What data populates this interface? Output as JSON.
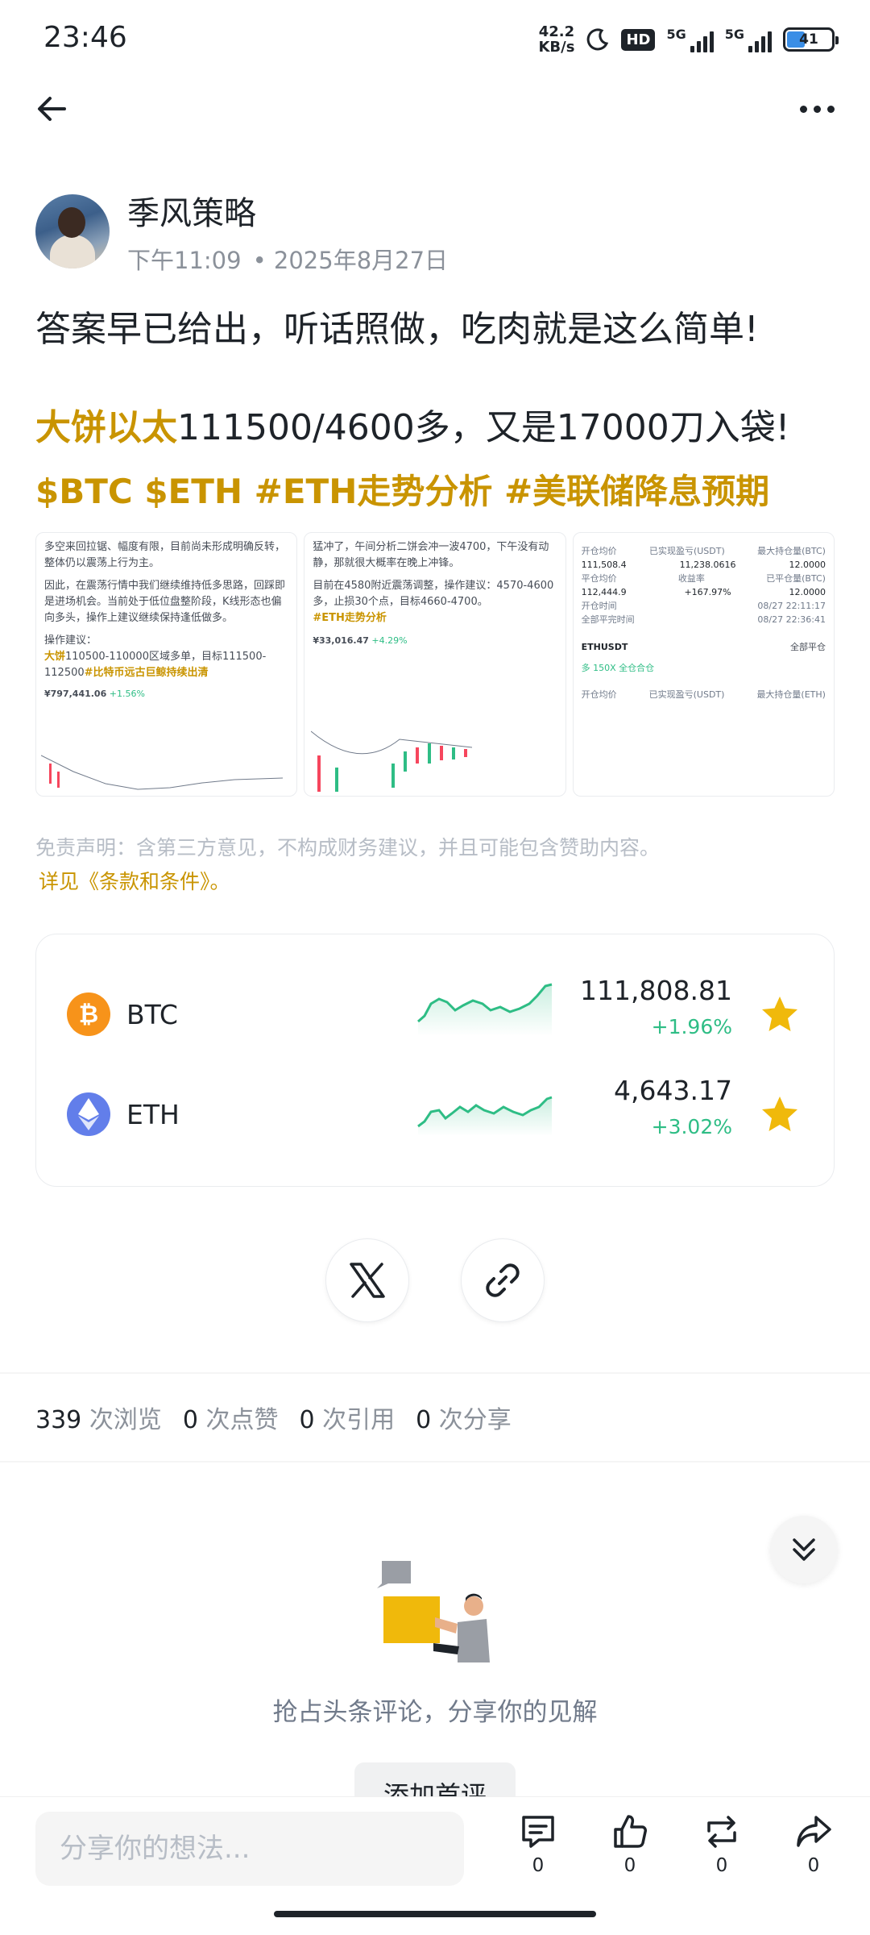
{
  "status_bar": {
    "time": "23:46",
    "net_speed_value": "42.2",
    "net_speed_unit": "KB/s",
    "hd_label": "HD",
    "signal1_label": "5G",
    "signal2_label": "5G",
    "battery": "41"
  },
  "nav": {
    "back_icon": "arrow-left-icon",
    "more_icon": "more-dots-icon"
  },
  "author": {
    "name": "季风策略",
    "time": "下午11:09",
    "date": "• 2025年8月27日"
  },
  "post": {
    "line1": "答案早已给出，听话照做，吃肉就是这么简单!",
    "highlight": "大饼以太",
    "line2_rest": "111500/4600多，又是17000刀入袋!",
    "tags": "$BTC $ETH #ETH走势分析 #美联储降息预期"
  },
  "screenshots": {
    "shot1": {
      "p1": "多空来回拉锯、幅度有限，目前尚未形成明确反转，整体仍以震荡上行为主。",
      "p2": "因此，在震荡行情中我们继续维持低多思路，回踩即是进场机会。当前处于低位盘整阶段，K线形态也偏向多头，操作上建议继续保持逢低做多。",
      "p3": "操作建议：",
      "p4_hl": "大饼",
      "p4": "110500-110000区域多单，目标111500-112500",
      "p4_tag": "#比特币远古巨鲸持续出清",
      "price": "¥797,441.06",
      "pct": "+1.56%"
    },
    "shot2": {
      "p1": "猛冲了，午间分析二饼会冲一波4700，下午没有动静，那就很大概率在晚上冲锋。",
      "p2": "目前在4580附近震荡调整，操作建议：4570-4600多，止损30个点，目标4660-4700。",
      "p2_tag": "#ETH走势分析",
      "price": "¥33,016.47",
      "pct": "+4.29%"
    },
    "shot3": {
      "rows": [
        [
          "开仓均价",
          "已实现盈亏(USDT)",
          "最大持仓量(BTC)"
        ],
        [
          "111,508.4",
          "11,238.0616",
          "12.0000"
        ],
        [
          "平仓均价",
          "收益率",
          "已平仓量(BTC)"
        ],
        [
          "112,444.9",
          "+167.97%",
          "12.0000"
        ],
        [
          "开仓时间",
          "",
          "08/27 22:11:17"
        ],
        [
          "全部平完时间",
          "",
          "08/27 22:36:41"
        ]
      ],
      "symbol": "ETHUSDT",
      "close_label": "全部平仓",
      "leverage": "多 150X 全仓合仓",
      "footer": [
        "开仓均价",
        "已实现盈亏(USDT)",
        "最大持仓量(ETH)"
      ]
    }
  },
  "disclaimer": {
    "text": "免责声明：含第三方意见，不构成财务建议，并且可能包含赞助内容。",
    "terms": "详见《条款和条件》。"
  },
  "tickers": [
    {
      "symbol": "BTC",
      "price": "111,808.81",
      "change": "+1.96%",
      "icon": "bitcoin-icon",
      "color": "#f7931a"
    },
    {
      "symbol": "ETH",
      "price": "4,643.17",
      "change": "+3.02%",
      "icon": "ethereum-icon",
      "color": "#627eea"
    }
  ],
  "share": {
    "x_icon": "x-logo-icon",
    "link_icon": "link-icon"
  },
  "stats": {
    "views": "339",
    "views_label": "次浏览",
    "likes": "0",
    "likes_label": "次点赞",
    "quotes": "0",
    "quotes_label": "次引用",
    "shares": "0",
    "shares_label": "次分享"
  },
  "comments": {
    "empty_text": "抢占头条评论，分享你的见解",
    "first_button": "添加首评"
  },
  "bottom_bar": {
    "input_placeholder": "分享你的想法...",
    "comment_count": "0",
    "like_count": "0",
    "repost_count": "0",
    "share_count": "0"
  },
  "colors": {
    "accent": "#c99400",
    "up": "#2ebd85",
    "star": "#f0b90b",
    "text": "#1e2329",
    "muted": "#8b919a"
  }
}
